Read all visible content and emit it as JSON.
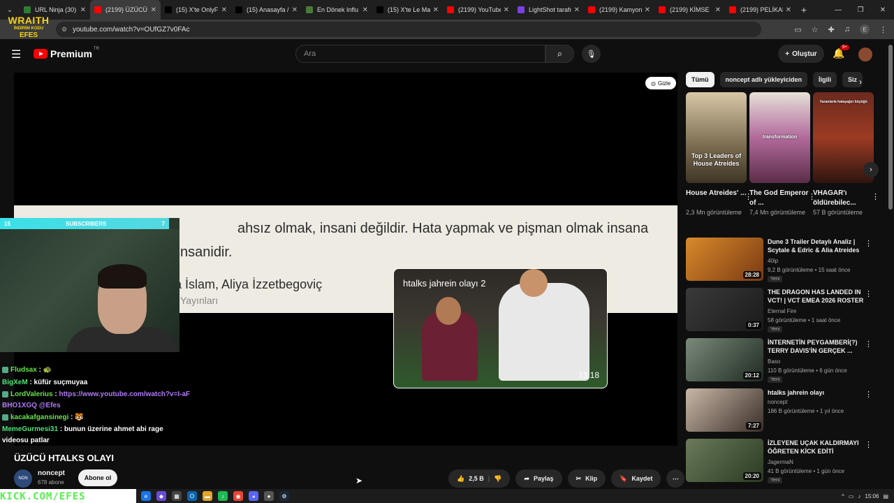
{
  "browser": {
    "tabs": [
      {
        "label": "URL Ninja (30)",
        "icon": "url-ninja-icon",
        "color": "#2e7d32"
      },
      {
        "label": "(2199) ÜZÜCÜ",
        "icon": "youtube-icon",
        "color": "#ff0000",
        "active": true
      },
      {
        "label": "(15) X'te OnlyF",
        "icon": "x-icon",
        "color": "#000000"
      },
      {
        "label": "(15) Anasayfa /",
        "icon": "x-icon",
        "color": "#000000"
      },
      {
        "label": "En Dönek Influ",
        "icon": "site-icon",
        "color": "#4a7a3a"
      },
      {
        "label": "(15) X'te Le Ma",
        "icon": "x-icon",
        "color": "#000000"
      },
      {
        "label": "(2199) YouTube",
        "icon": "youtube-icon",
        "color": "#ff0000"
      },
      {
        "label": "LightShot tarafı",
        "icon": "lightshot-icon",
        "color": "#7b3fe4"
      },
      {
        "label": "(2199) Kamyon",
        "icon": "youtube-icon",
        "color": "#ff0000"
      },
      {
        "label": "(2199) KİMSE",
        "icon": "youtube-icon",
        "color": "#ff0000"
      },
      {
        "label": "(2199) PELİKAN",
        "icon": "youtube-icon",
        "color": "#ff0000"
      }
    ],
    "url": "youtube.com/watch?v=OUfGZ7v0FAc",
    "profile_letter": "E"
  },
  "youtube": {
    "premium_label": "Premium",
    "region": "TR",
    "search_placeholder": "Ara",
    "create_label": "Oluştur",
    "notif_count": "9+"
  },
  "player": {
    "hide_label": "Gizle",
    "quote_line1": "ahsız olmak, insani değildir. Hata yapmak ve pişman olmak insana",
    "quote_line2": "nsanidir.",
    "quote_line3": "nda İslam, Aliya İzzetbegoviç",
    "quote_line4": "Yayınları",
    "upnext_title": "htalks jahrein olayı 2",
    "upnext_duration": "13:18"
  },
  "stream_overlay": {
    "sub_left": "15",
    "sub_label": "SUBSCRIBERS",
    "sub_right": "7",
    "watermark_top": "WRAITH",
    "watermark_mid": "İNDİRİM KODU",
    "watermark_code": "EFES",
    "watermark_bottom": "KICK.COM/EFES"
  },
  "chat": [
    {
      "name": "Fludsax",
      "msg": ":"
    },
    {
      "name": "BigXeM",
      "msg": ": küfür suçmuyaa"
    },
    {
      "name": "LordValerius",
      "msg": ": ",
      "link": "https://www.youtube.com/watch?v=I-aFBHO1XGQ",
      "extra": "@Efes"
    },
    {
      "name": "kacakafgansinegi",
      "msg": ":"
    },
    {
      "name": "MemeGurmesi31",
      "msg": ": bunun üzerine ahmet abi rage videosu patlar"
    }
  ],
  "video": {
    "title": "ÜZÜCÜ HTALKS OLAYI",
    "channel": "noncept",
    "subs": "678 abone",
    "subscribe_label": "Abone ol",
    "likes": "2,5 B",
    "share_label": "Paylaş",
    "clip_label": "Klip",
    "save_label": "Kaydet"
  },
  "sidebar": {
    "chips": [
      "Tümü",
      "noncept adlı yükleyiciden",
      "İlgili",
      "Siz"
    ],
    "shorts": [
      {
        "caption": "Top 3 Leaders of House Atreides",
        "title": "House Atreides' ...",
        "views": "2,3 Mn görüntüleme"
      },
      {
        "caption": "transformation",
        "title": "The God Emperor of ...",
        "views": "7,4 Mn görüntüleme"
      },
      {
        "caption": "Yazanlarla halaşağın büyüğü",
        "title": "VHAGAR'ı öldürebilec...",
        "views": "57 B görüntüleme"
      }
    ],
    "videos": [
      {
        "title": "Dune 3 Trailer Detaylı Analiz | Scytale & Edric & Alia Atreides",
        "channel": "40ip",
        "views": "9,2 B görüntüleme • 15 saat önce",
        "badge": "Yeni",
        "duration": "28:28"
      },
      {
        "title": "THE DRAGON HAS LANDED IN VCT! | VCT EMEA 2026 ROSTER",
        "channel": "Eternal Fire",
        "views": "58 görüntüleme • 1 saat önce",
        "badge": "Yeni",
        "duration": "0:37"
      },
      {
        "title": "İNTERNETİN PEYGAMBERİ(?) TERRY DAVIS'İN GERÇEK ...",
        "channel": "Baso",
        "views": "110 B görüntüleme • 6 gün önce",
        "badge": "Yeni",
        "duration": "20:12"
      },
      {
        "title": "htalks jahrein olayı",
        "channel": "noncept",
        "views": "186 B görüntüleme • 1 yıl önce",
        "badge": "",
        "duration": "7:27"
      },
      {
        "title": "İZLEYENE UÇAK KALDIRMAYI ÖĞRETEN KİCK EDİTİ",
        "channel": "JagermaN",
        "views": "41 B görüntüleme • 1 gün önce",
        "badge": "Yeni",
        "duration": "20:20"
      }
    ]
  },
  "taskbar": {
    "time": "15:06"
  }
}
